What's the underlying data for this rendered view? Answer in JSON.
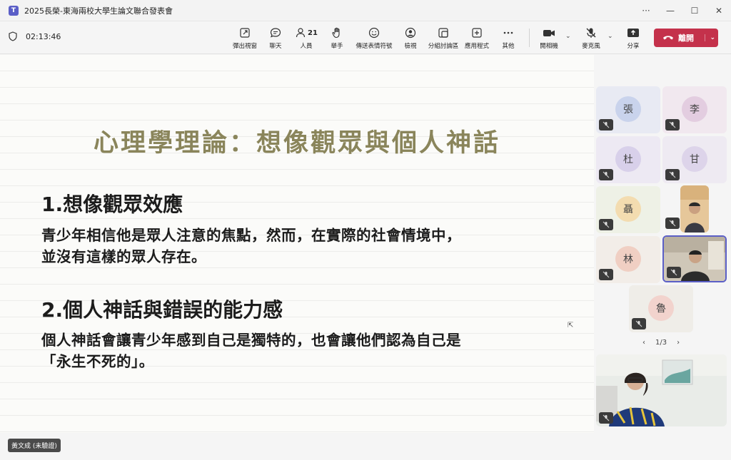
{
  "window": {
    "title": "2025長榮-東海兩校大學生論文聯合發表會",
    "app_icon": "T"
  },
  "toolbar": {
    "timer": "02:13:46",
    "buttons": [
      {
        "id": "popout",
        "label": "彈出視窗",
        "icon": "popout-icon"
      },
      {
        "id": "chat",
        "label": "聊天",
        "icon": "chat-icon"
      },
      {
        "id": "people",
        "label": "人員",
        "icon": "people-icon",
        "count": "21"
      },
      {
        "id": "raise",
        "label": "舉手",
        "icon": "hand-icon"
      },
      {
        "id": "react",
        "label": "傳送表情符號",
        "icon": "emoji-icon"
      },
      {
        "id": "view",
        "label": "檢視",
        "icon": "view-icon"
      },
      {
        "id": "rooms",
        "label": "分組討論區",
        "icon": "rooms-icon"
      },
      {
        "id": "apps",
        "label": "應用程式",
        "icon": "apps-icon"
      },
      {
        "id": "more",
        "label": "其他",
        "icon": "more-icon"
      }
    ],
    "camera_label": "開相機",
    "mic_label": "麥克風",
    "share_label": "分享",
    "leave_label": "離開"
  },
  "slide": {
    "title": "心理學理論：想像觀眾與個人神話",
    "point1": {
      "heading": "1.想像觀眾效應",
      "line1": "青少年相信他是眾人注意的焦點，然而，在實際的社會情境中，",
      "line2": "並沒有這樣的眾人存在。"
    },
    "point2": {
      "heading": "2.個人神話與錯誤的能力感",
      "line1": "個人神話會讓青少年感到自己是獨特的，也會讓他們認為自己是",
      "line2": "「永生不死的」。"
    }
  },
  "participants": [
    {
      "initial": "張",
      "bg": "#e8eaf3",
      "avatar": "#c9d3ec"
    },
    {
      "initial": "李",
      "bg": "#f1e8ef",
      "avatar": "#e3cde0"
    },
    {
      "initial": "杜",
      "bg": "#ede9f3",
      "avatar": "#d8d0ea"
    },
    {
      "initial": "甘",
      "bg": "#eeeaf2",
      "avatar": "#ddd4ea"
    },
    {
      "initial": "聶",
      "bg": "#eef1e6",
      "avatar": "#f3dcb0"
    },
    {
      "initial": "林",
      "bg": "#f2ede8",
      "avatar": "#f0cfc3"
    },
    {
      "initial": "魯",
      "bg": "#efede8",
      "avatar": "#f2d3cd"
    }
  ],
  "pager": {
    "text": "1/3"
  },
  "self_name": "黃文成 (未驗證)"
}
